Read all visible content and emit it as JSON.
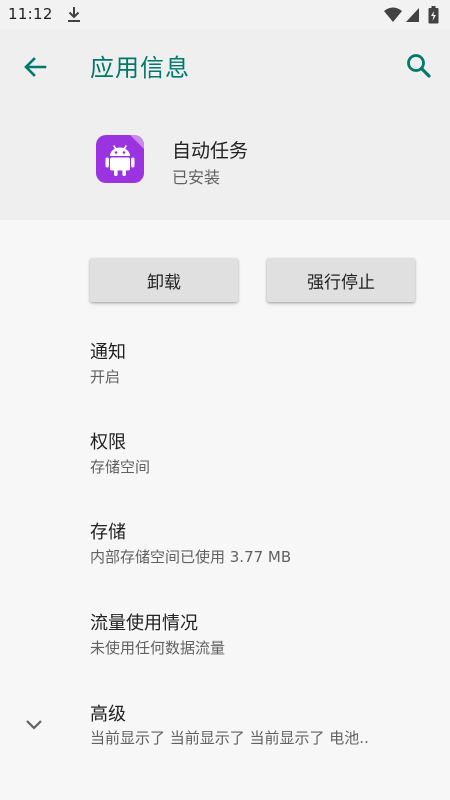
{
  "status_bar": {
    "time": "11:12",
    "icons": [
      "download-icon",
      "wifi-icon",
      "signal-icon",
      "battery-icon"
    ]
  },
  "header": {
    "title": "应用信息",
    "back_icon": "arrow-back-icon",
    "search_icon": "search-icon"
  },
  "app": {
    "name": "自动任务",
    "status": "已安装",
    "icon": "android-icon",
    "icon_color": "#9b34e0"
  },
  "buttons": {
    "uninstall": "卸载",
    "force_stop": "强行停止"
  },
  "preferences": [
    {
      "title": "通知",
      "summary": "开启"
    },
    {
      "title": "权限",
      "summary": "存储空间"
    },
    {
      "title": "存储",
      "summary": "内部存储空间已使用 3.77 MB"
    },
    {
      "title": "流量使用情况",
      "summary": "未使用任何数据流量"
    },
    {
      "title": "高级",
      "summary": "当前显示了 当前显示了 当前显示了 电池.."
    }
  ],
  "colors": {
    "accent": "#00796b",
    "header_background": "#efefef",
    "page_background": "#f7f7f7"
  }
}
